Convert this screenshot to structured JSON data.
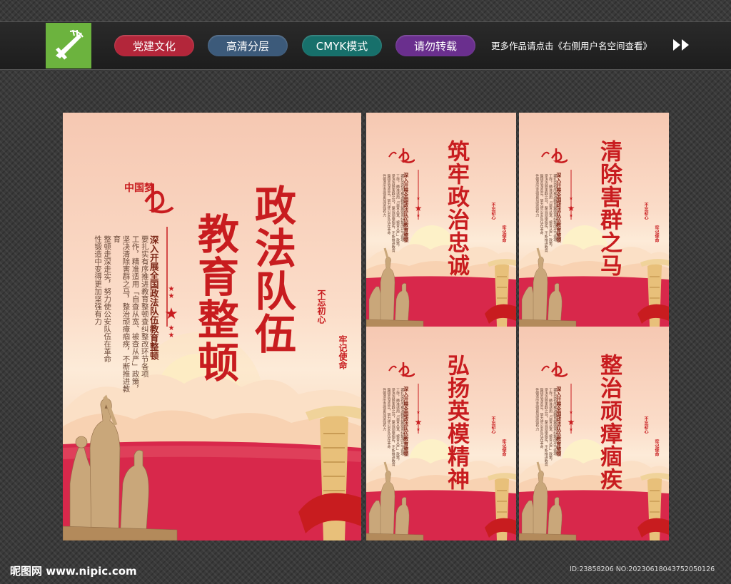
{
  "banner": {
    "pills": [
      {
        "label": "党建文化",
        "color": "#b3263a"
      },
      {
        "label": "高清分层",
        "color": "#3c5a7a"
      },
      {
        "label": "CMYK模式",
        "color": "#17706b"
      },
      {
        "label": "请勿转载",
        "color": "#6a2f8e"
      }
    ],
    "more_text": "更多作品请点击《右侧用户名空间查看》"
  },
  "main_poster": {
    "title_line1": "政法队伍",
    "title_line2": "教育整顿",
    "subtitle": "深入开展全国政法队伍教育整顿",
    "body_lines": [
      "要扎实有序推进教育整顿查纠整改环节各项",
      "工作，精准适用「自查从宽、被查从严」政策，",
      "坚决清除害群之马，整治顽瘴痼疾，不断推进教育",
      "整顿走深走实，努力使公安队伍在革命",
      "性锻造中变得更加坚强有力"
    ],
    "logo_text": "中国梦",
    "motto_a": "不忘初心",
    "motto_b": "牢记使命"
  },
  "small_posters": [
    {
      "title": "筑牢政治忠诚",
      "subtitle": "深入开展全国政法队伍教育整顿",
      "motto_a": "不忘初心",
      "motto_b": "牢记使命"
    },
    {
      "title": "清除害群之马",
      "subtitle": "深入开展全国政法队伍教育整顿",
      "motto_a": "不忘初心",
      "motto_b": "牢记使命"
    },
    {
      "title": "弘扬英模精神",
      "subtitle": "深入开展全国政法队伍教育整顿",
      "motto_a": "不忘初心",
      "motto_b": "牢记使命"
    },
    {
      "title": "整治顽瘴痼疾",
      "subtitle": "深入开展全国政法队伍教育整顿",
      "motto_a": "不忘初心",
      "motto_b": "牢记使命"
    }
  ],
  "footer": {
    "site": "昵图网 www.nipic.com",
    "id_text": "ID:23858206 NO:20230618043752050126"
  },
  "colors": {
    "accent_red": "#c81c1f",
    "poster_pink": "#f6c8b2",
    "banner_bg": "#1d1d1d",
    "logo_green": "#6cb33e"
  }
}
